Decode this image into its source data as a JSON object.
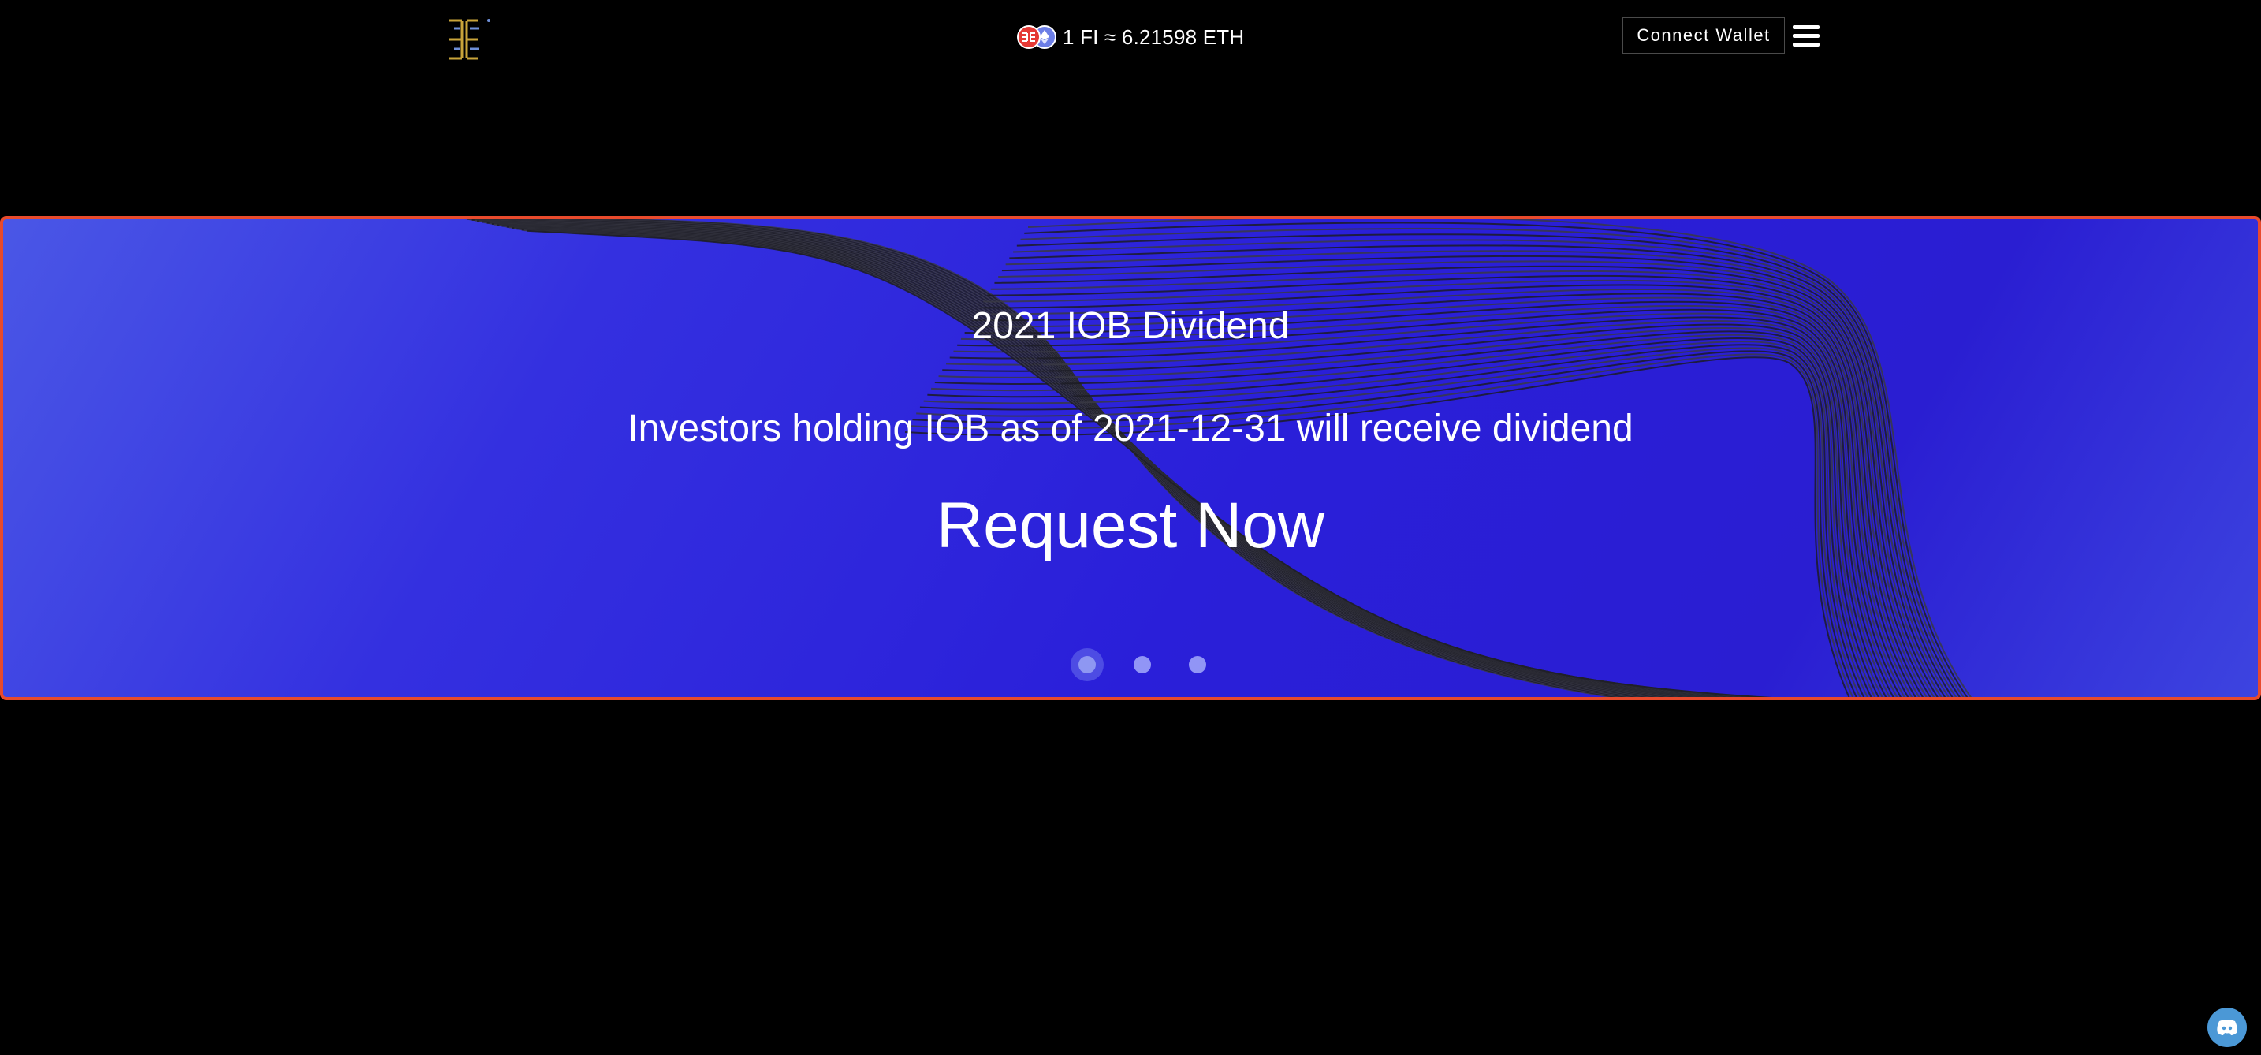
{
  "header": {
    "logo_icon": "brand-logo-icon",
    "price_ticker": {
      "fi_coin_icon": "fi-coin-icon",
      "eth_coin_icon": "eth-coin-icon",
      "text": "1 FI ≈ 6.21598 ETH"
    },
    "connect_wallet_label": "Connect Wallet",
    "menu_icon": "hamburger-menu-icon"
  },
  "banner": {
    "title": "2021 IOB Dividend",
    "subtitle": "Investors holding IOB as of 2021-12-31 will receive dividend",
    "cta_label": "Request Now",
    "slides_count": 3,
    "active_slide": 1
  },
  "floating": {
    "discord_icon": "discord-icon"
  },
  "colors": {
    "page_background": "#000000",
    "banner_gradient_start": "#4a57e6",
    "banner_gradient_end": "#2a1ed2",
    "banner_border": "#e84a2c",
    "fi_coin": "#e53935",
    "eth_coin": "#6c7ee6",
    "discord_button": "#4b98d6",
    "logo_gold": "#c9a43a",
    "logo_blue": "#6e8fd8"
  }
}
